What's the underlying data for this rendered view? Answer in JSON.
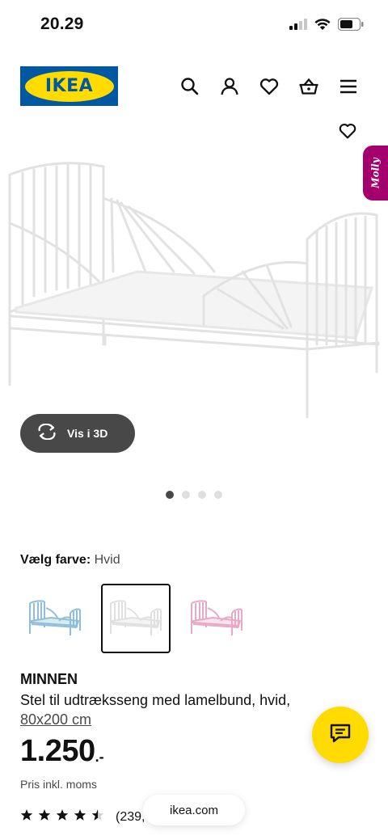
{
  "status_bar": {
    "time": "20.29"
  },
  "header": {
    "logo_text": "IKEA",
    "icons": [
      "search-icon",
      "user-icon",
      "heart-icon",
      "basket-icon",
      "menu-icon"
    ]
  },
  "gallery": {
    "badge_text": "Molly",
    "view_3d_label": "Vis i 3D",
    "dots_count": 4,
    "active_dot": 0
  },
  "color_selector": {
    "label": "Vælg farve:",
    "value": "Hvid",
    "swatches": [
      {
        "name": "light-blue",
        "color": "#8fbfd6",
        "selected": false
      },
      {
        "name": "white",
        "color": "#e6e6e6",
        "selected": true
      },
      {
        "name": "pink",
        "color": "#e7a9c6",
        "selected": false
      }
    ]
  },
  "product": {
    "name": "MINNEN",
    "description": "Stel til udtræksseng med lamelbund, hvid,",
    "size": "80x200 cm",
    "price": "1.250",
    "price_suffix": ".-",
    "price_note": "Pris inkl. moms",
    "rating_stars": 4.5,
    "rating_count": "(239,"
  },
  "browser": {
    "url": "ikea.com"
  },
  "colors": {
    "ikea_blue": "#0058a3",
    "ikea_yellow": "#ffdb00",
    "molly_purple": "#a3006e",
    "dark_pill": "#484848"
  }
}
